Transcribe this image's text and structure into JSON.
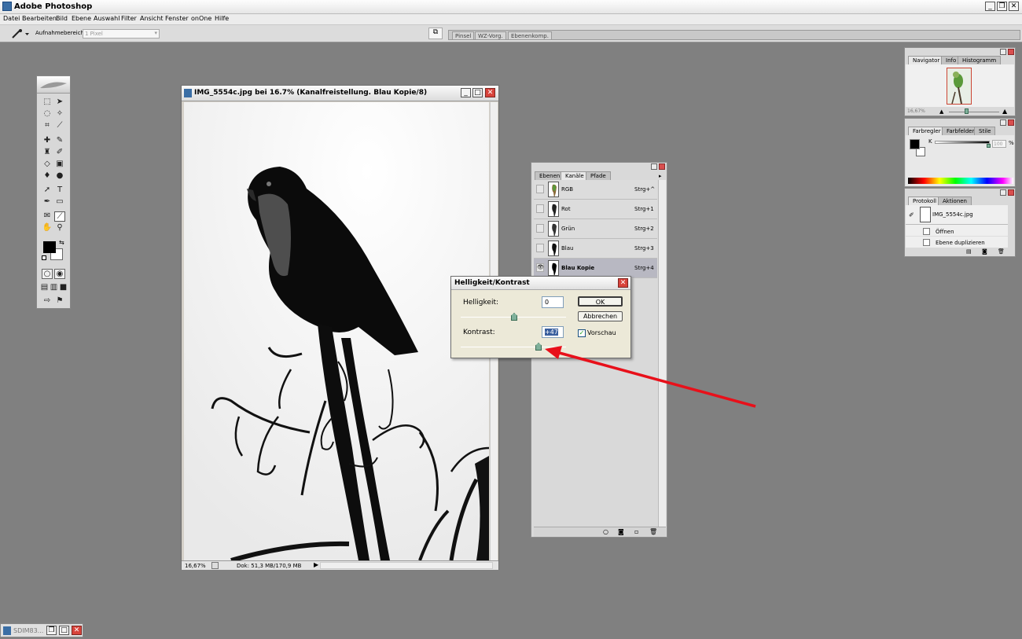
{
  "app": {
    "title": "Adobe Photoshop"
  },
  "menu": [
    "Datei",
    "Bearbeiten",
    "Bild",
    "Ebene",
    "Auswahl",
    "Filter",
    "Ansicht",
    "Fenster",
    "onOne",
    "Hilfe"
  ],
  "options": {
    "sample_label": "Aufnahmebereich:",
    "sample_value": "1 Pixel"
  },
  "well_tabs": [
    "Pinsel",
    "WZ-Vorg.",
    "Ebenenkomp."
  ],
  "document": {
    "title": "IMG_5554c.jpg bei 16.7% (Kanalfreistellung. Blau Kopie/8)",
    "zoom": "16,67%",
    "status": "Dok: 51,3 MB/170,9 MB"
  },
  "navigator": {
    "tabs": [
      "Navigator",
      "Info",
      "Histogramm"
    ],
    "zoom": "16,67%"
  },
  "color": {
    "tabs": [
      "Farbregler",
      "Farbfelder",
      "Stile"
    ],
    "channel": "K",
    "value": "100",
    "unit": "%"
  },
  "history": {
    "tabs": [
      "Protokoll",
      "Aktionen"
    ],
    "snapshot": "IMG_5554c.jpg",
    "items": [
      "Öffnen",
      "Ebene duplizieren"
    ]
  },
  "channels": {
    "tabs": [
      "Ebenen",
      "Kanäle",
      "Pfade"
    ],
    "rows": [
      {
        "name": "RGB",
        "shortcut": "Strg+^"
      },
      {
        "name": "Rot",
        "shortcut": "Strg+1"
      },
      {
        "name": "Grün",
        "shortcut": "Strg+2"
      },
      {
        "name": "Blau",
        "shortcut": "Strg+3"
      },
      {
        "name": "Blau Kopie",
        "shortcut": "Strg+4"
      }
    ]
  },
  "dialog": {
    "title": "Helligkeit/Kontrast",
    "brightness_label": "Helligkeit:",
    "brightness_value": "0",
    "contrast_label": "Kontrast:",
    "contrast_value": "+47",
    "ok": "OK",
    "cancel": "Abbrechen",
    "preview": "Vorschau",
    "preview_checked": true
  },
  "taskbar": {
    "label": "SDIM83..."
  },
  "annotation": {
    "arrow_color": "#e8101a"
  }
}
